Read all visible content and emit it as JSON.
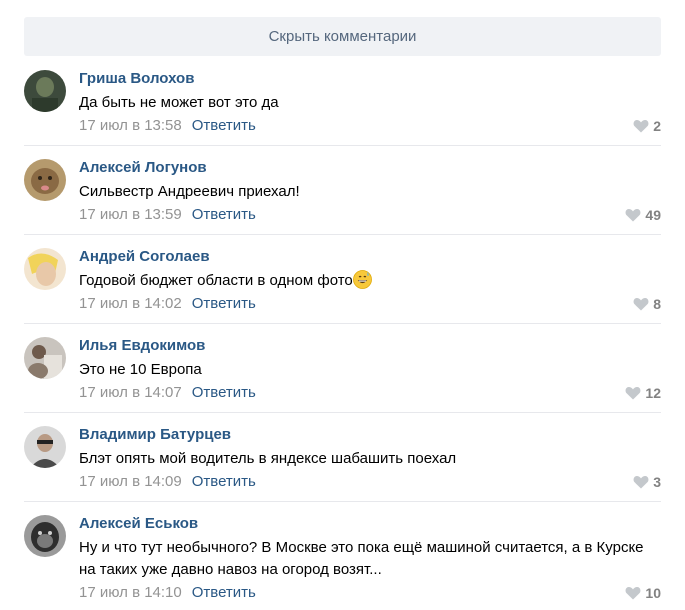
{
  "hide_comments_label": "Скрыть комментарии",
  "reply_label": "Ответить",
  "comments": [
    {
      "author": "Гриша Волохов",
      "text": "Да быть не может вот это да",
      "time": "17 июл в 13:58",
      "likes": "2",
      "avatar_colors": [
        "#3d4a3c",
        "#6b7a5a"
      ]
    },
    {
      "author": "Алексей Логунов",
      "text": "Сильвестр Андреевич приехал!",
      "time": "17 июл в 13:59",
      "likes": "49",
      "avatar_colors": [
        "#b59a6d",
        "#8a6a44"
      ]
    },
    {
      "author": "Андрей Соголаев",
      "text": "Годовой бюджет области в одном фото",
      "emoji": "grinning-sweat-emoji",
      "time": "17 июл в 14:02",
      "likes": "8",
      "avatar_colors": [
        "#e8c8a8",
        "#f1d35a"
      ]
    },
    {
      "author": "Илья Евдокимов",
      "text": "Это не 10 Европа",
      "time": "17 июл в 14:07",
      "likes": "12",
      "avatar_colors": [
        "#c9c4be",
        "#6e5a4c"
      ]
    },
    {
      "author": "Владимир Батурцев",
      "text": "Блэт опять мой водитель в яндексе шабашить поехал",
      "time": "17 июл в 14:09",
      "likes": "3",
      "avatar_colors": [
        "#d9d9d9",
        "#4a4a4a"
      ]
    },
    {
      "author": "Алексей Еськов",
      "text": "Ну и что тут необычного? В Москве это пока ещё машиной считается, а в Курске на таких уже давно навоз на огород возят...",
      "time": "17 июл в 14:10",
      "likes": "10",
      "avatar_colors": [
        "#9a9a9a",
        "#2e2e2e"
      ]
    }
  ],
  "colors": {
    "link": "#2a5885",
    "meta": "#939393",
    "button_bg": "#f0f2f5",
    "separator": "#e7e8ec"
  }
}
